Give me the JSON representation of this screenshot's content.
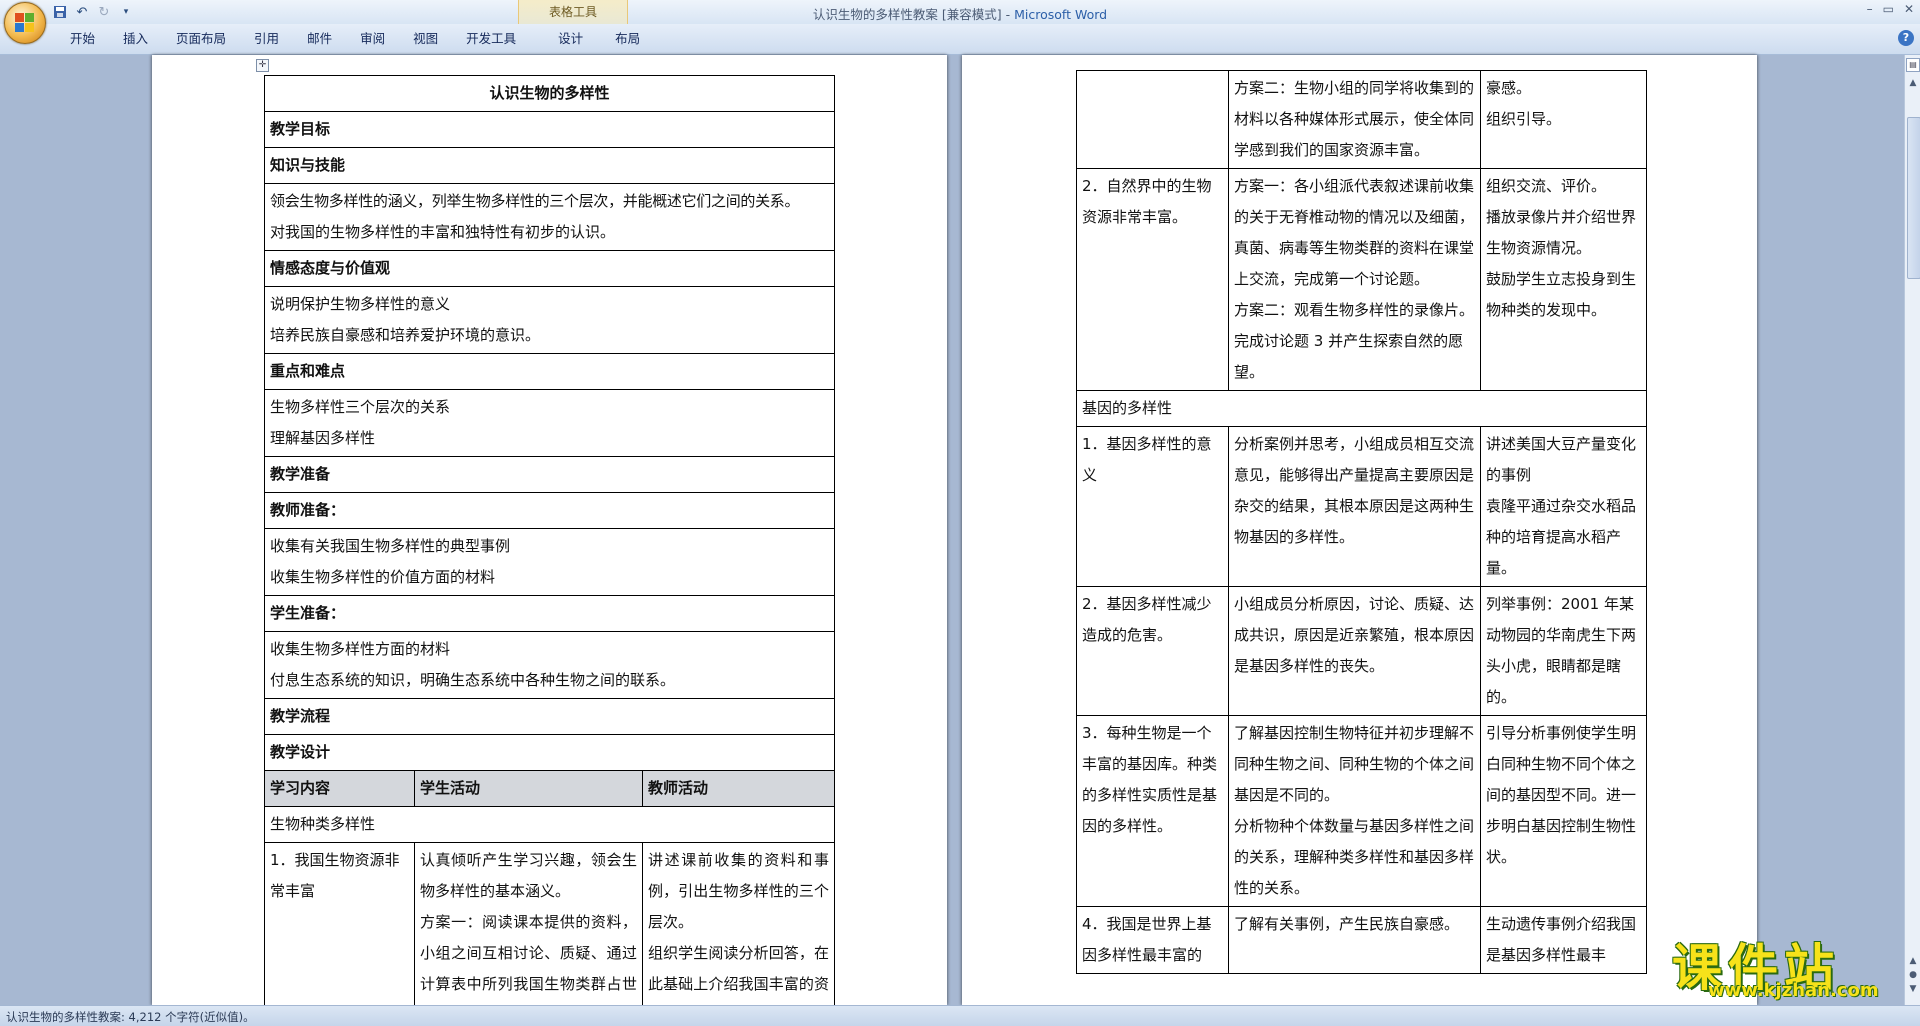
{
  "window": {
    "title_doc": "认识生物的多样性教案 [兼容模式] - ",
    "title_app": "Microsoft Word",
    "context_group": "表格工具",
    "controls": [
      "–",
      "▭",
      "✕"
    ]
  },
  "ribbon": {
    "tabs": [
      "开始",
      "插入",
      "页面布局",
      "引用",
      "邮件",
      "审阅",
      "视图",
      "开发工具",
      "设计",
      "布局"
    ]
  },
  "status": {
    "text": "认识生物的多样性教案: 4,212 个字符(近似值)。"
  },
  "watermark": {
    "brand": "课件站",
    "url": "www.kjzhan.com"
  },
  "page1": {
    "title": "认识生物的多样性",
    "teaching_goal": "教学目标",
    "knowledge_skill": "知识与技能",
    "ks_lines": [
      "领会生物多样性的涵义，列举生物多样性的三个层次，并能概述它们之间的关系。",
      "对我国的生物多样性的丰富和独特性有初步的认识。"
    ],
    "attitude": "情感态度与价值观",
    "att_lines": [
      "说明保护生物多样性的意义",
      "培养民族自豪感和培养爱护环境的意识。"
    ],
    "key_points": "重点和难点",
    "kp_lines": [
      "生物多样性三个层次的关系",
      "理解基因多样性"
    ],
    "prep": "教学准备",
    "teacher_prep": "教师准备：",
    "tp_lines": [
      "收集有关我国生物多样性的典型事例",
      "收集生物多样性的价值方面的材料"
    ],
    "student_prep": "学生准备：",
    "sp_lines": [
      "收集生物多样性方面的材料",
      "付息生态系统的知识，明确生态系统中各种生物之间的联系。"
    ],
    "flow": "教学流程",
    "design": "教学设计",
    "headers": [
      "学习内容",
      "学生活动",
      "教师活动"
    ],
    "section_species": "生物种类多样性",
    "row1": {
      "content": "1．我国生物资源非常丰富",
      "student": [
        "认真倾听产生学习兴趣，领会生物多样性的基本涵义。",
        "方案一：阅读课本提供的资料，小组之间互相讨论、质疑、通过计算表中所列我国生物类群占世界的总百分比，忍痛我国生物资源丰富。"
      ],
      "teacher": [
        "讲述课前收集的资料和事例，引出生物多样性的三个层次。",
        "组织学生阅读分析回答，在此基础上介绍我国丰富的资源情况，激发学生民族自"
      ]
    }
  },
  "page2": {
    "row0": {
      "content": "",
      "student": [
        "方案二：生物小组的同学将收集到的材料以各种媒体形式展示，使全体同学感到我们的国家资源丰富。"
      ],
      "teacher": [
        "豪感。",
        "组织引导。"
      ]
    },
    "row_nature": {
      "content": "2．自然界中的生物资源非常丰富。",
      "student": [
        "方案一：各小组派代表叙述课前收集的关于无脊椎动物的情况以及细菌，真菌、病毒等生物类群的资料在课堂上交流，完成第一个讨论题。",
        "方案二：观看生物多样性的录像片。完成讨论题 3 并产生探索自然的愿望。"
      ],
      "teacher": [
        "组织交流、评价。",
        "播放录像片并介绍世界生物资源情况。",
        "鼓励学生立志投身到生物种类的发现中。"
      ]
    },
    "section_gene": "基因的多样性",
    "rows": [
      {
        "content": "1．基因多样性的意义",
        "student": [
          "分析案例并思考，小组成员相互交流意见，能够得出产量提高主要原因是杂交的结果，其根本原因是这两种生物基因的多样性。"
        ],
        "teacher": [
          "讲述美国大豆产量变化的事例",
          "袁隆平通过杂交水稻品种的培育提高水稻产量。"
        ]
      },
      {
        "content": "2．基因多样性减少造成的危害。",
        "student": [
          "小组成员分析原因，讨论、质疑、达成共识，原因是近亲繁殖，根本原因是基因多样性的丧失。"
        ],
        "teacher": [
          "列举事例：2001 年某动物园的华南虎生下两头小虎，眼睛都是瞎的。"
        ]
      },
      {
        "content": "3．每种生物是一个丰富的基因库。种类的多样性实质性是基因的多样性。",
        "student": [
          "了解基因控制生物特征并初步理解不同种生物之间、同种生物的个体之间基因是不同的。",
          "分析物种个体数量与基因多样性之间的关系，理解种类多样性和基因多样性的关系。"
        ],
        "teacher": [
          "引导分析事例使学生明白同种生物不同个体之间的基因型不同。进一步明白基因控制生物性状。"
        ]
      },
      {
        "content": "4．我国是世界上基因多样性最丰富的",
        "student": [
          "了解有关事例，产生民族自豪感。"
        ],
        "teacher": [
          "生动遗传事例介绍我国是基因多样性最丰"
        ]
      }
    ]
  }
}
